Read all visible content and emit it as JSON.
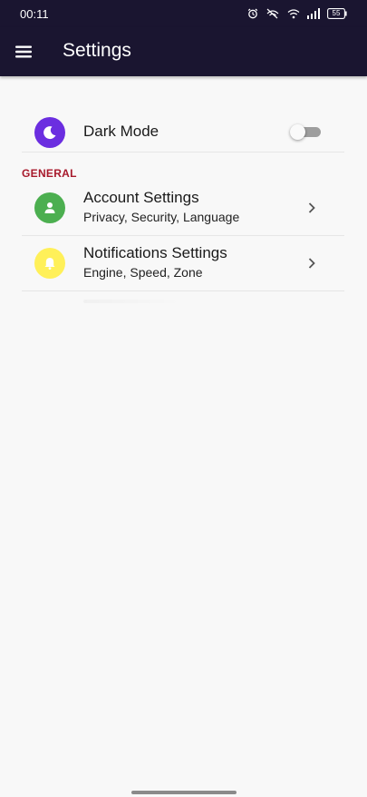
{
  "status_bar": {
    "time": "00:11",
    "battery": "55",
    "icons": [
      "alarm-icon",
      "signal-slash-icon",
      "wifi-icon",
      "cell-signal-icon",
      "battery-icon"
    ]
  },
  "app_bar": {
    "title": "Settings",
    "menu_icon": "hamburger-menu-icon",
    "background": "#1a1530"
  },
  "dark_mode": {
    "label": "Dark Mode",
    "icon": "moon-icon",
    "icon_color": "#6b2ee0",
    "enabled": false
  },
  "section": {
    "title": "GENERAL",
    "color": "#a7192b"
  },
  "items": [
    {
      "title": "Account Settings",
      "subtitle": "Privacy, Security, Language",
      "icon": "person-icon",
      "icon_color": "#4caf50"
    },
    {
      "title": "Notifications Settings",
      "subtitle": "Engine, Speed, Zone",
      "icon": "bell-icon",
      "icon_color": "#fff059"
    }
  ]
}
